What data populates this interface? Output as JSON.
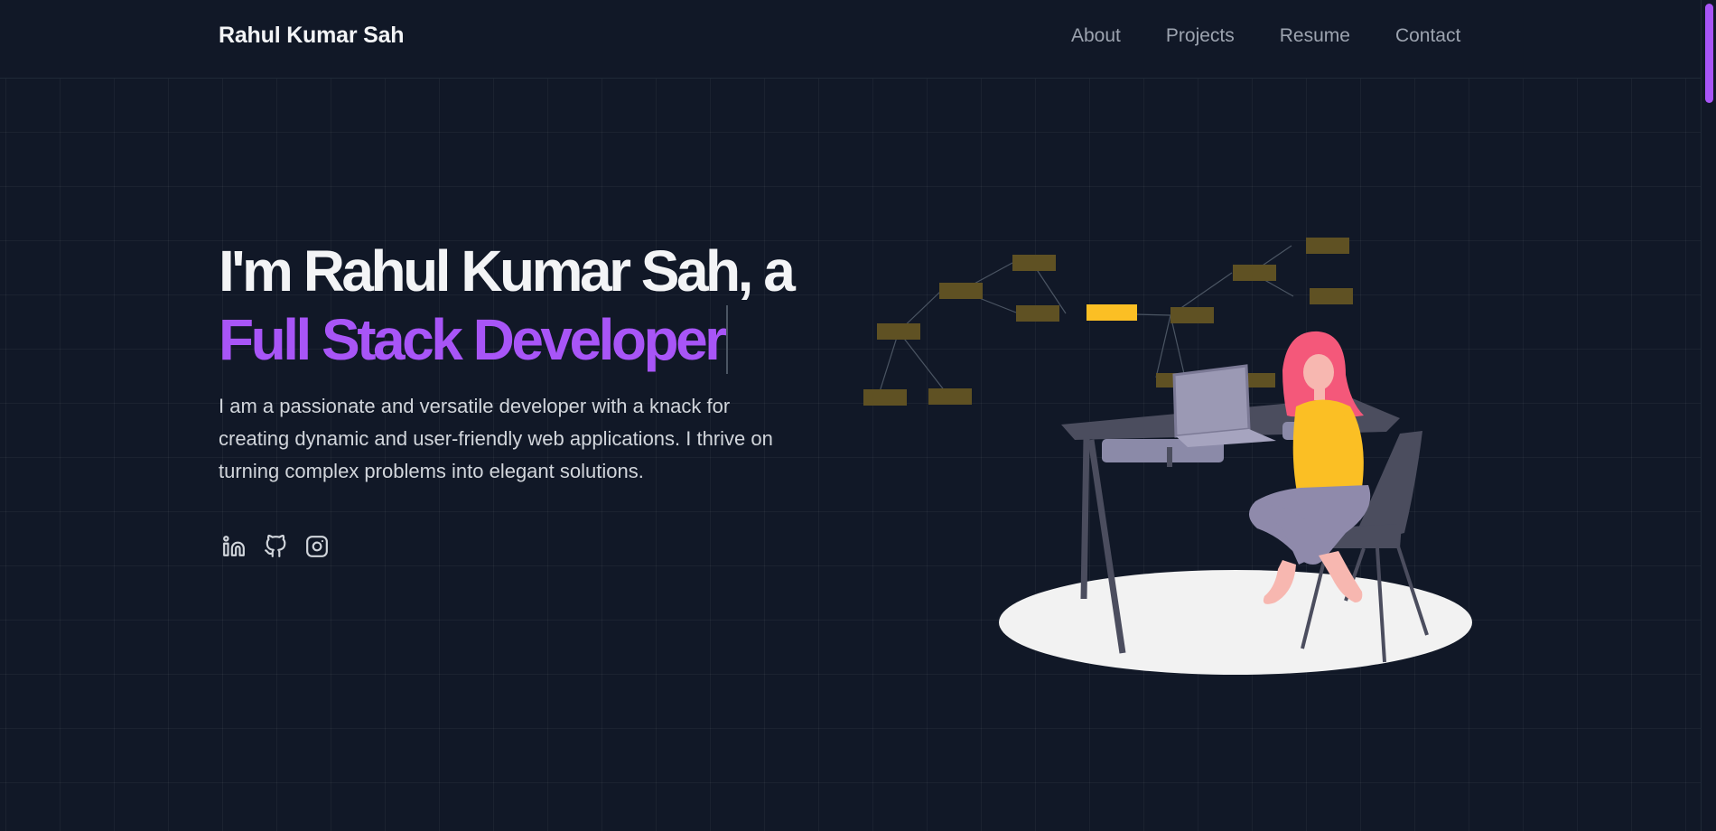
{
  "header": {
    "brand": "Rahul Kumar Sah",
    "nav": [
      {
        "label": "About"
      },
      {
        "label": "Projects"
      },
      {
        "label": "Resume"
      },
      {
        "label": "Contact"
      }
    ]
  },
  "hero": {
    "headline_line1": "I'm Rahul Kumar Sah, a",
    "headline_role": "Full Stack Developer",
    "intro": "I am a passionate and versatile developer with a knack for creating dynamic and user-friendly web applications. I thrive on turning complex problems into elegant solutions."
  },
  "socials": [
    {
      "icon": "linkedin-icon"
    },
    {
      "icon": "github-icon"
    },
    {
      "icon": "instagram-icon"
    }
  ],
  "colors": {
    "background": "#111827",
    "accent": "#a855f7",
    "text": "#f3f4f6",
    "muted": "#9ca3af",
    "highlight": "#fbbf24"
  }
}
